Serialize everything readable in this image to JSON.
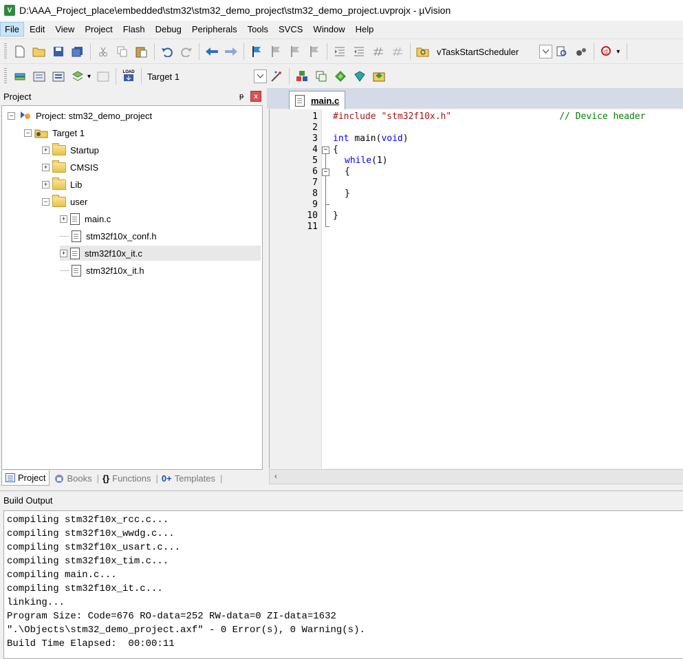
{
  "window": {
    "title": "D:\\AAA_Project_place\\embedded\\stm32\\stm32_demo_project\\stm32_demo_project.uvprojx - µVision",
    "app_icon_text": "V"
  },
  "menu": [
    "File",
    "Edit",
    "View",
    "Project",
    "Flash",
    "Debug",
    "Peripherals",
    "Tools",
    "SVCS",
    "Window",
    "Help"
  ],
  "toolbar": {
    "find_combo_value": "vTaskStartScheduler",
    "target_combo_value": "Target 1",
    "load_label": "LOAD"
  },
  "project_panel": {
    "title": "Project",
    "pin_glyph": "ᵽ",
    "close_glyph": "x",
    "tree": {
      "root": "Project: stm32_demo_project",
      "target": "Target 1",
      "groups": [
        "Startup",
        "CMSIS",
        "Lib",
        "user"
      ],
      "user_files": [
        "main.c",
        "stm32f10x_conf.h",
        "stm32f10x_it.c",
        "stm32f10x_it.h"
      ]
    },
    "tabs": [
      "Project",
      "Books",
      "Functions",
      "Templates"
    ],
    "tab_icons": [
      "{}",
      "0+"
    ]
  },
  "editor": {
    "active_tab": "main.c",
    "line_numbers": [
      "1",
      "2",
      "3",
      "4",
      "5",
      "6",
      "7",
      "8",
      "9",
      "10",
      "11"
    ],
    "code": {
      "l1_directive": "#include",
      "l1_string": "\"stm32f10x.h\"",
      "l1_comment": "// Device header",
      "l3_type": "int",
      "l3_name": "main(",
      "l3_param": "void",
      "l3_close": ")",
      "l4": "{",
      "l5_kw": "while",
      "l5_rest": "(1)",
      "l6": "{",
      "l8": "}",
      "l10": "}"
    }
  },
  "build_output": {
    "title": "Build Output",
    "lines": [
      "compiling stm32f10x_rcc.c...",
      "compiling stm32f10x_wwdg.c...",
      "compiling stm32f10x_usart.c...",
      "compiling stm32f10x_tim.c...",
      "compiling main.c...",
      "compiling stm32f10x_it.c...",
      "linking...",
      "Program Size: Code=676 RO-data=252 RW-data=0 ZI-data=1632",
      "\".\\Objects\\stm32_demo_project.axf\" - 0 Error(s), 0 Warning(s).",
      "Build Time Elapsed:  00:00:11"
    ]
  }
}
